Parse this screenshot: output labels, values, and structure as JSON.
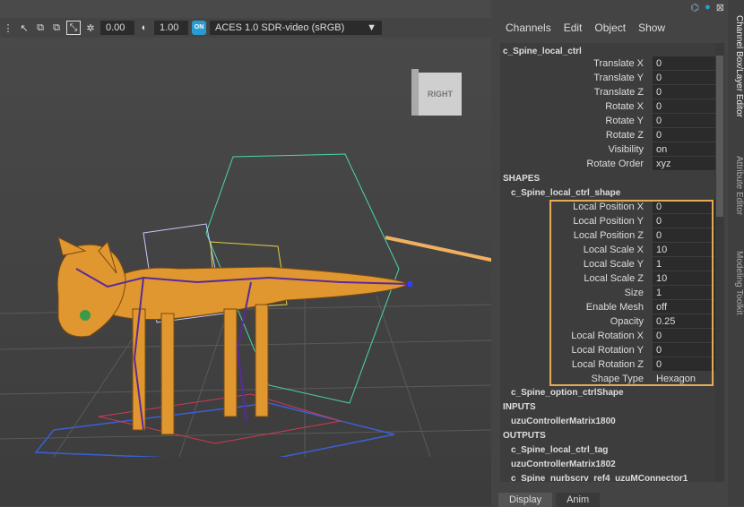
{
  "toolbar": {
    "field1": "0.00",
    "field2": "1.00",
    "on_badge": "ON",
    "colorspace": "ACES 1.0 SDR-video (sRGB)"
  },
  "viewcube": {
    "face": "RIGHT"
  },
  "menu": [
    "Channels",
    "Edit",
    "Object",
    "Show"
  ],
  "node_name": "c_Spine_local_ctrl",
  "channels": [
    {
      "label": "Translate X",
      "value": "0"
    },
    {
      "label": "Translate Y",
      "value": "0"
    },
    {
      "label": "Translate Z",
      "value": "0"
    },
    {
      "label": "Rotate X",
      "value": "0"
    },
    {
      "label": "Rotate Y",
      "value": "0"
    },
    {
      "label": "Rotate Z",
      "value": "0"
    },
    {
      "label": "Visibility",
      "value": "on"
    },
    {
      "label": "Rotate Order",
      "value": "xyz"
    }
  ],
  "shapes_header": "SHAPES",
  "shape_node": "c_Spine_local_ctrl_shape",
  "shape_channels": [
    {
      "label": "Local Position X",
      "value": "0"
    },
    {
      "label": "Local Position Y",
      "value": "0"
    },
    {
      "label": "Local Position Z",
      "value": "0"
    },
    {
      "label": "Local Scale X",
      "value": "10"
    },
    {
      "label": "Local Scale Y",
      "value": "1"
    },
    {
      "label": "Local Scale Z",
      "value": "10"
    },
    {
      "label": "Size",
      "value": "1"
    },
    {
      "label": "Enable Mesh",
      "value": "off"
    },
    {
      "label": "Opacity",
      "value": "0.25"
    },
    {
      "label": "Local Rotation X",
      "value": "0"
    },
    {
      "label": "Local Rotation Y",
      "value": "0"
    },
    {
      "label": "Local Rotation Z",
      "value": "0"
    },
    {
      "label": "Shape Type",
      "value": "Hexagon"
    }
  ],
  "option_shape": "c_Spine_option_ctrlShape",
  "inputs_header": "INPUTS",
  "input_node": "uzuControllerMatrix1800",
  "outputs_header": "OUTPUTS",
  "outputs": [
    "c_Spine_local_ctrl_tag",
    "uzuControllerMatrix1802",
    "c_Spine_nurbscrv_ref4_uzuMConnector1"
  ],
  "bottom_tabs": [
    "Display",
    "Anim"
  ],
  "side_tabs": [
    "Channel Box/Layer Editor",
    "Attribute Editor",
    "Modeling Toolkit"
  ],
  "colors": {
    "highlight": "#e8a957",
    "accent": "#2a9bd0"
  }
}
